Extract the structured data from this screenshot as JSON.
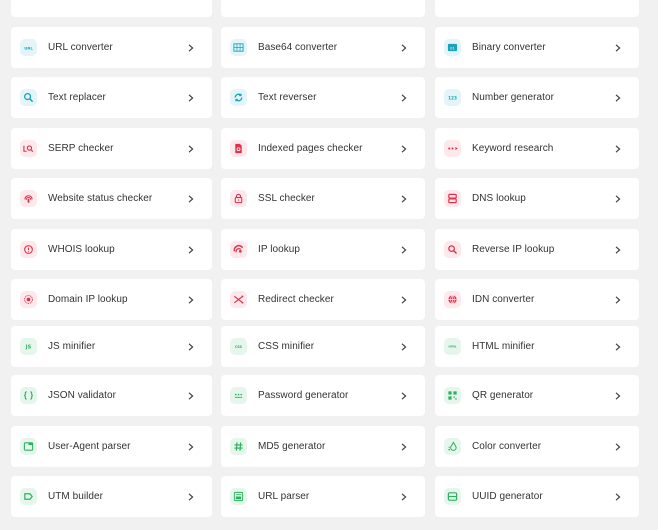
{
  "colors": {
    "background": "#f1f1f1",
    "card": "#ffffff",
    "text": "#333333",
    "teal_accent": "#1aa3b8",
    "red_accent": "#e0314b",
    "green_accent": "#2bb160"
  },
  "tools": [
    {
      "label": "URL converter",
      "icon": "url-badge-icon",
      "tone": "teal"
    },
    {
      "label": "Base64 converter",
      "icon": "grid-icon",
      "tone": "teal"
    },
    {
      "label": "Binary converter",
      "icon": "binary-icon",
      "tone": "teal"
    },
    {
      "label": "Text replacer",
      "icon": "search-replace-icon",
      "tone": "teal"
    },
    {
      "label": "Text reverser",
      "icon": "refresh-icon",
      "tone": "teal"
    },
    {
      "label": "Number generator",
      "icon": "numbers-123-icon",
      "tone": "teal"
    },
    {
      "label": "SERP checker",
      "icon": "serp-search-icon",
      "tone": "red"
    },
    {
      "label": "Indexed pages checker",
      "icon": "document-search-icon",
      "tone": "red"
    },
    {
      "label": "Keyword research",
      "icon": "keyword-icon",
      "tone": "red"
    },
    {
      "label": "Website status checker",
      "icon": "signal-icon",
      "tone": "red"
    },
    {
      "label": "SSL checker",
      "icon": "lock-icon",
      "tone": "red"
    },
    {
      "label": "DNS lookup",
      "icon": "server-icon",
      "tone": "red"
    },
    {
      "label": "WHOIS lookup",
      "icon": "info-circle-icon",
      "tone": "red"
    },
    {
      "label": "IP lookup",
      "icon": "ip-radar-icon",
      "tone": "red"
    },
    {
      "label": "Reverse IP lookup",
      "icon": "magnifier-icon",
      "tone": "red"
    },
    {
      "label": "Domain IP lookup",
      "icon": "target-icon",
      "tone": "red"
    },
    {
      "label": "Redirect checker",
      "icon": "shuffle-icon",
      "tone": "red"
    },
    {
      "label": "IDN converter",
      "icon": "globe-icon",
      "tone": "red"
    },
    {
      "label": "JS minifier",
      "icon": "js-badge-icon",
      "tone": "green"
    },
    {
      "label": "CSS minifier",
      "icon": "css-badge-icon",
      "tone": "green"
    },
    {
      "label": "HTML minifier",
      "icon": "html-badge-icon",
      "tone": "green"
    },
    {
      "label": "JSON validator",
      "icon": "braces-icon",
      "tone": "green"
    },
    {
      "label": "Password generator",
      "icon": "password-dots-icon",
      "tone": "green"
    },
    {
      "label": "QR generator",
      "icon": "qr-code-icon",
      "tone": "green"
    },
    {
      "label": "User-Agent parser",
      "icon": "browser-window-icon",
      "tone": "green"
    },
    {
      "label": "MD5 generator",
      "icon": "hash-icon",
      "tone": "green"
    },
    {
      "label": "Color converter",
      "icon": "color-drop-icon",
      "tone": "green"
    },
    {
      "label": "UTM builder",
      "icon": "tag-icon",
      "tone": "green"
    },
    {
      "label": "URL parser",
      "icon": "url-parser-icon",
      "tone": "green"
    },
    {
      "label": "UUID generator",
      "icon": "uuid-card-icon",
      "tone": "green"
    }
  ]
}
